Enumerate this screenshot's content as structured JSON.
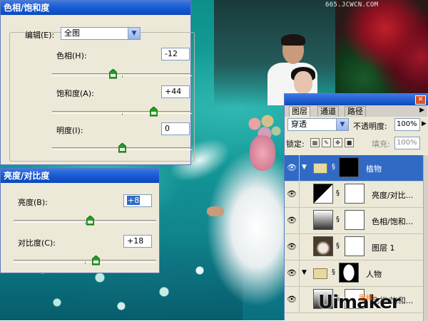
{
  "watermark": "665.JCWCN.COM",
  "hue_dialog": {
    "title": "色相/饱和度",
    "edit_label": "编辑(E):",
    "edit_value": "全图",
    "hue_label": "色相(H):",
    "hue_value": "-12",
    "saturation_label": "饱和度(A):",
    "saturation_value": "+44",
    "lightness_label": "明度(I):",
    "lightness_value": "0",
    "levels": {
      "hue": -12,
      "saturation": 44,
      "lightness": 0
    }
  },
  "bc_dialog": {
    "title": "亮度/对比度",
    "brightness_label": "亮度(B):",
    "brightness_value": "+8",
    "contrast_label": "对比度(C):",
    "contrast_value": "+18",
    "levels": {
      "brightness": 8,
      "contrast": 18
    }
  },
  "layers_panel": {
    "tabs": [
      "图层",
      "通道",
      "路径"
    ],
    "blend_mode": "穿透",
    "opacity_label": "不透明度:",
    "opacity_value": "100%",
    "lock_label": "锁定:",
    "fill_label": "填充:",
    "fill_value": "100%",
    "layers": [
      {
        "name": "植物",
        "type": "group",
        "active": true
      },
      {
        "name": "亮度/对比...",
        "type": "adjustment",
        "active": false
      },
      {
        "name": "色相/饱和...",
        "type": "adjustment",
        "active": false
      },
      {
        "name": "图层 1",
        "type": "pixel",
        "active": false
      },
      {
        "name": "人物",
        "type": "group",
        "active": false
      },
      {
        "name": "色相/饱和...",
        "type": "adjustment",
        "active": false
      }
    ]
  },
  "logo_text": "Uimaker",
  "logo_sub": "思缘"
}
